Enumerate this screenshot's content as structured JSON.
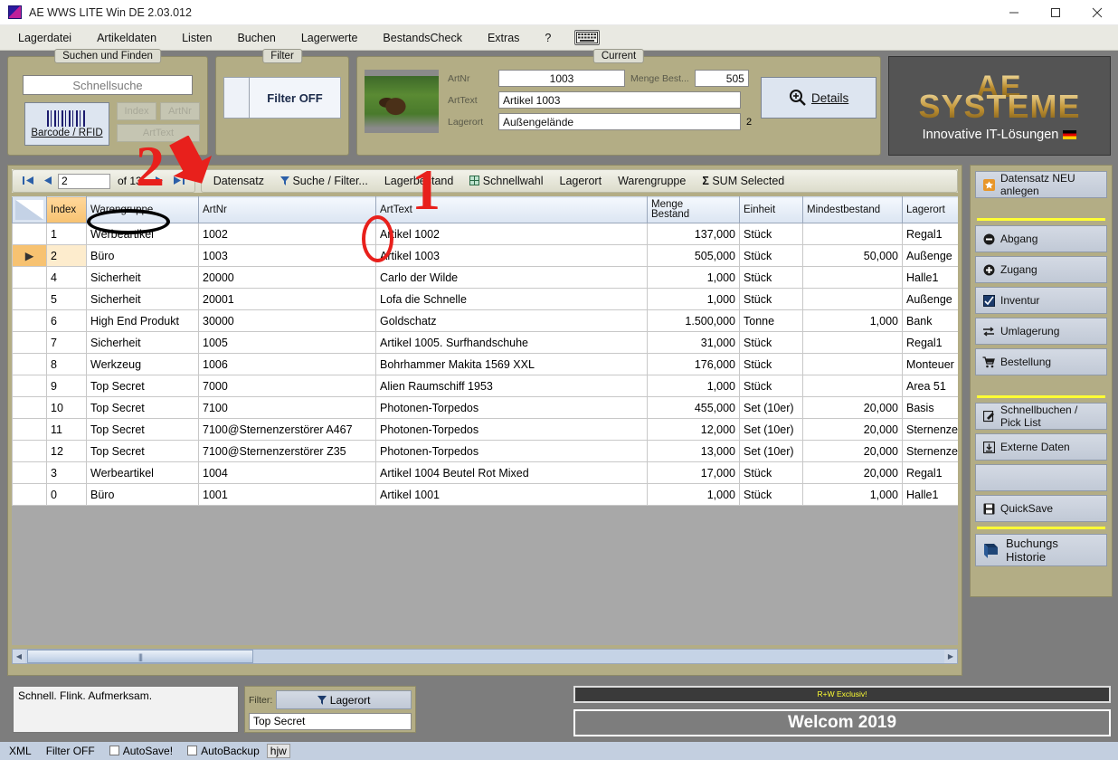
{
  "window": {
    "title": "AE WWS LITE Win DE 2.03.012",
    "minimize": "minimize-icon",
    "maximize": "maximize-icon",
    "close": "close-icon"
  },
  "menu": {
    "items": [
      "Lagerdatei",
      "Artikeldaten",
      "Listen",
      "Buchen",
      "Lagerwerte",
      "BestandsCheck",
      "Extras",
      "?"
    ],
    "keyboard_icon": "keyboard-icon"
  },
  "toolbar": {
    "search_group": {
      "title": "Suchen und Finden",
      "quick_search_placeholder": "Schnellsuche",
      "barcode_label": "Barcode / RFID",
      "buttons": [
        "Index",
        "ArtNr",
        "ArtText"
      ]
    },
    "filter_group": {
      "title": "Filter",
      "filter_button": "Filter OFF"
    },
    "current_group": {
      "title": "Current",
      "artnr_label": "ArtNr",
      "artnr_value": "1003",
      "menge_label": "Menge Best...",
      "menge_value": "505",
      "arttext_label": "ArtText",
      "arttext_value": "Artikel 1003",
      "lagerort_label": "Lagerort",
      "lagerort_value": "Außengelände",
      "lagerort_suffix": "2",
      "details_button": "Details",
      "photo": "bear-photo"
    },
    "logo": {
      "line1": "AE",
      "line2": "SYSTEME",
      "tagline": "Innovative IT-Lösungen"
    }
  },
  "nav": {
    "first": "first-record-icon",
    "prev": "prev-record-icon",
    "record_value": "2",
    "of_label": "of 13",
    "next": "next-record-icon",
    "last": "last-record-icon",
    "actions": [
      "Datensatz",
      "Suche / Filter...",
      "Lagerbestand",
      "Schnellwahl",
      "Lagerort",
      "Warengruppe",
      "SUM Selected"
    ]
  },
  "grid": {
    "columns": [
      "Index",
      "Warengruppe",
      "ArtNr",
      "ArtText",
      "Menge Bestand",
      "Einheit",
      "Mindestbestand",
      "Lagerort"
    ],
    "rows": [
      {
        "marker": "",
        "index": "1",
        "warengruppe": "Werbeartikel",
        "artnr": "1002",
        "arttext": "Artikel 1002",
        "menge": "137,000",
        "einheit": "Stück",
        "mindest": "",
        "lagerort": "Regal1",
        "current": false
      },
      {
        "marker": "▶",
        "index": "2",
        "warengruppe": "Büro",
        "artnr": "1003",
        "arttext": "Artikel 1003",
        "menge": "505,000",
        "einheit": "Stück",
        "mindest": "50,000",
        "lagerort": "Außenge",
        "current": true
      },
      {
        "marker": "",
        "index": "4",
        "warengruppe": "Sicherheit",
        "artnr": "20000",
        "arttext": "Carlo der Wilde",
        "menge": "1,000",
        "einheit": "Stück",
        "mindest": "",
        "lagerort": "Halle1",
        "current": false
      },
      {
        "marker": "",
        "index": "5",
        "warengruppe": "Sicherheit",
        "artnr": "20001",
        "arttext": "Lofa die Schnelle",
        "menge": "1,000",
        "einheit": "Stück",
        "mindest": "",
        "lagerort": "Außenge",
        "current": false
      },
      {
        "marker": "",
        "index": "6",
        "warengruppe": "High End Produkt",
        "artnr": "30000",
        "arttext": "Goldschatz",
        "menge": "1.500,000",
        "einheit": "Tonne",
        "mindest": "1,000",
        "lagerort": "Bank",
        "current": false
      },
      {
        "marker": "",
        "index": "7",
        "warengruppe": "Sicherheit",
        "artnr": "1005",
        "arttext": "Artikel 1005. Surfhandschuhe",
        "menge": "31,000",
        "einheit": "Stück",
        "mindest": "",
        "lagerort": "Regal1",
        "current": false
      },
      {
        "marker": "",
        "index": "8",
        "warengruppe": "Werkzeug",
        "artnr": "1006",
        "arttext": "Bohrhammer Makita 1569 XXL",
        "menge": "176,000",
        "einheit": "Stück",
        "mindest": "",
        "lagerort": "Monteuer",
        "current": false
      },
      {
        "marker": "",
        "index": "9",
        "warengruppe": "Top Secret",
        "artnr": "7000",
        "arttext": "Alien Raumschiff 1953",
        "menge": "1,000",
        "einheit": "Stück",
        "mindest": "",
        "lagerort": "Area 51",
        "current": false
      },
      {
        "marker": "",
        "index": "10",
        "warengruppe": "Top Secret",
        "artnr": "7100",
        "arttext": "Photonen-Torpedos",
        "menge": "455,000",
        "einheit": "Set (10er)",
        "mindest": "20,000",
        "lagerort": "Basis",
        "current": false
      },
      {
        "marker": "",
        "index": "11",
        "warengruppe": "Top Secret",
        "artnr": "7100@Sternenzerstörer A467",
        "arttext": "Photonen-Torpedos",
        "menge": "12,000",
        "einheit": "Set (10er)",
        "mindest": "20,000",
        "lagerort": "Sternenze",
        "current": false
      },
      {
        "marker": "",
        "index": "12",
        "warengruppe": "Top Secret",
        "artnr": "7100@Sternenzerstörer Z35",
        "arttext": "Photonen-Torpedos",
        "menge": "13,000",
        "einheit": "Set (10er)",
        "mindest": "20,000",
        "lagerort": "Sternenze",
        "current": false
      },
      {
        "marker": "",
        "index": "3",
        "warengruppe": "Werbeartikel",
        "artnr": "1004",
        "arttext": "Artikel 1004 Beutel Rot Mixed",
        "menge": "17,000",
        "einheit": "Stück",
        "mindest": "20,000",
        "lagerort": "Regal1",
        "current": false
      },
      {
        "marker": "",
        "index": "0",
        "warengruppe": "Büro",
        "artnr": "1001",
        "arttext": "Artikel 1001",
        "menge": "1,000",
        "einheit": "Stück",
        "mindest": "1,000",
        "lagerort": "Halle1",
        "current": false
      }
    ]
  },
  "sidebar": {
    "new_record": "Datensatz NEU anlegen",
    "actions": [
      {
        "label": "Abgang",
        "icon": "minus-circle-icon"
      },
      {
        "label": "Zugang",
        "icon": "plus-circle-icon"
      },
      {
        "label": "Inventur",
        "icon": "clipboard-check-icon"
      },
      {
        "label": "Umlagerung",
        "icon": "transfer-arrows-icon"
      },
      {
        "label": "Bestellung",
        "icon": "shopping-cart-icon"
      }
    ],
    "secondary": [
      {
        "label": "Schnellbuchen / Pick List",
        "icon": "edit-square-icon"
      },
      {
        "label": "Externe Daten",
        "icon": "download-box-icon"
      }
    ],
    "quicksave": {
      "label": "QuickSave",
      "icon": "floppy-disk-icon"
    },
    "history": {
      "label": "Buchungs Historie",
      "icon": "book-icon"
    }
  },
  "bottom": {
    "memo": "Schnell. Flink. Aufmerksam.",
    "filter_label": "Filter:",
    "filter_button": "Lagerort",
    "filter_value": "Top Secret",
    "banner_small": "R+W Exclusiv!",
    "banner_large": "Welcom 2019"
  },
  "status": {
    "format": "XML",
    "filter": "Filter OFF",
    "autosave": "AutoSave!",
    "autobackup": "AutoBackup",
    "user": "hjw"
  },
  "annotations": {
    "number_one": "1",
    "number_two": "2",
    "color": "#e8201c"
  }
}
